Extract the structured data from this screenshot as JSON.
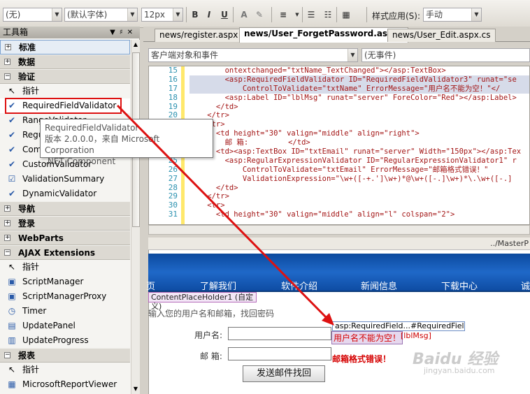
{
  "toolbar": {
    "style_combo": "(无)",
    "font_combo": "(默认字体)",
    "size_combo": "12px",
    "bold": "B",
    "italic": "I",
    "underline": "U",
    "style_apply_label": "样式应用(S):",
    "style_apply_value": "手动"
  },
  "toolbox": {
    "title": "工具箱",
    "rows": [
      {
        "type": "cat",
        "label": "标准",
        "open": false,
        "selected": true
      },
      {
        "type": "cat",
        "label": "数据",
        "open": false
      },
      {
        "type": "cat",
        "label": "验证",
        "open": true
      },
      {
        "type": "item",
        "label": "指针",
        "icon": "pointer-icon"
      },
      {
        "type": "item",
        "label": "RequiredFieldValidator",
        "icon": "validator-icon",
        "highlighted": true
      },
      {
        "type": "item",
        "label": "RangeValidator",
        "icon": "validator-icon"
      },
      {
        "type": "item",
        "label": "RegularExpressionValidator",
        "icon": "validator-icon"
      },
      {
        "type": "item",
        "label": "CompareValidator",
        "icon": "validator-icon"
      },
      {
        "type": "item",
        "label": "CustomValidator",
        "icon": "validator-icon"
      },
      {
        "type": "item",
        "label": "ValidationSummary",
        "icon": "summary-icon"
      },
      {
        "type": "item",
        "label": "DynamicValidator",
        "icon": "validator-icon"
      },
      {
        "type": "cat",
        "label": "导航",
        "open": false
      },
      {
        "type": "cat",
        "label": "登录",
        "open": false
      },
      {
        "type": "cat",
        "label": "WebParts",
        "open": false
      },
      {
        "type": "cat",
        "label": "AJAX Extensions",
        "open": true
      },
      {
        "type": "item",
        "label": "指针",
        "icon": "pointer-icon"
      },
      {
        "type": "item",
        "label": "ScriptManager",
        "icon": "component-icon"
      },
      {
        "type": "item",
        "label": "ScriptManagerProxy",
        "icon": "component-icon"
      },
      {
        "type": "item",
        "label": "Timer",
        "icon": "timer-icon"
      },
      {
        "type": "item",
        "label": "UpdatePanel",
        "icon": "panel-icon"
      },
      {
        "type": "item",
        "label": "UpdateProgress",
        "icon": "progress-icon"
      },
      {
        "type": "cat",
        "label": "报表",
        "open": true
      },
      {
        "type": "item",
        "label": "指针",
        "icon": "pointer-icon"
      },
      {
        "type": "item",
        "label": "MicrosoftReportViewer",
        "icon": "report-icon"
      }
    ]
  },
  "tooltip": {
    "name": "RequiredFieldValidator",
    "version": "版本 2.0.0.0，来自 Microsoft Corporation",
    "kind": ".NET Component"
  },
  "tabs": [
    {
      "label": "news/register.aspx",
      "active": false
    },
    {
      "label": "news/User_ForgetPassword.aspx*",
      "active": true
    },
    {
      "label": "news/User_Edit.aspx.cs",
      "active": false
    }
  ],
  "editor": {
    "object_combo": "客户端对象和事件",
    "event_combo": "(无事件)",
    "line_numbers": [
      "15",
      "16",
      "17",
      "18",
      "19",
      "20",
      "21",
      "22",
      "23",
      "24",
      "25",
      "26",
      "27",
      "28",
      "29",
      "30",
      "31"
    ],
    "lines": [
      "        ontextchanged=\"txtName_TextChanged\"></asp:TextBox>",
      "        <asp:RequiredFieldValidator ID=\"RequiredFieldValidator3\" runat=\"se",
      "            ControlToValidate=\"txtName\" ErrorMessage=\"用户名不能为空！\"</",
      "        <asp:Label ID=\"lblMsg\" runat=\"server\" ForeColor=\"Red\"></asp:Label>",
      "      </td>",
      "    </tr>",
      "    <tr>",
      "      <td height=\"30\" valign=\"middle\" align=\"right\">",
      "        邮 箱:         </td>",
      "      <td><asp:TextBox ID=\"txtEmail\" runat=\"server\" Width=\"150px\"></asp:Tex",
      "        <asp:RegularExpressionValidator ID=\"RegularExpressionValidator1\" r",
      "            ControlToValidate=\"txtEmail\" ErrorMessage=\"邮箱格式错误！\"",
      "            ValidationExpression=\"\\w+([-+.']\\w+)*@\\w+([-.]\\w+)*\\.\\w+([-.]",
      "      </td>",
      "    </tr>",
      "    <tr>",
      "      <td height=\"30\" valign=\"middle\" align=\"l\" colspan=\"2\">"
    ]
  },
  "design": {
    "path": "../MasterP",
    "nav_links": [
      "页",
      "了解我们",
      "软件介绍",
      "新闻信息",
      "下载中心",
      "诚"
    ],
    "placeholder": "ContentPlaceHolder1 (自定义)",
    "prompt": "输入您的用户名和邮箱，找回密码",
    "username_label": "用户名:",
    "email_label": "邮 箱:",
    "send_button": "发送邮件找回",
    "validator_tag": "asp:RequiredField...#RequiredField...",
    "validator_message": "用户名不能为空！",
    "label_tag": "[lblMsg]",
    "email_error": "邮箱格式错误！",
    "watermark": "Baidu 经验",
    "watermark_url": "jingyan.baidu.com"
  },
  "colors": {
    "highlight_red": "#dd1111",
    "nav_blue": "#1f68c8",
    "error_red": "#d50000"
  }
}
